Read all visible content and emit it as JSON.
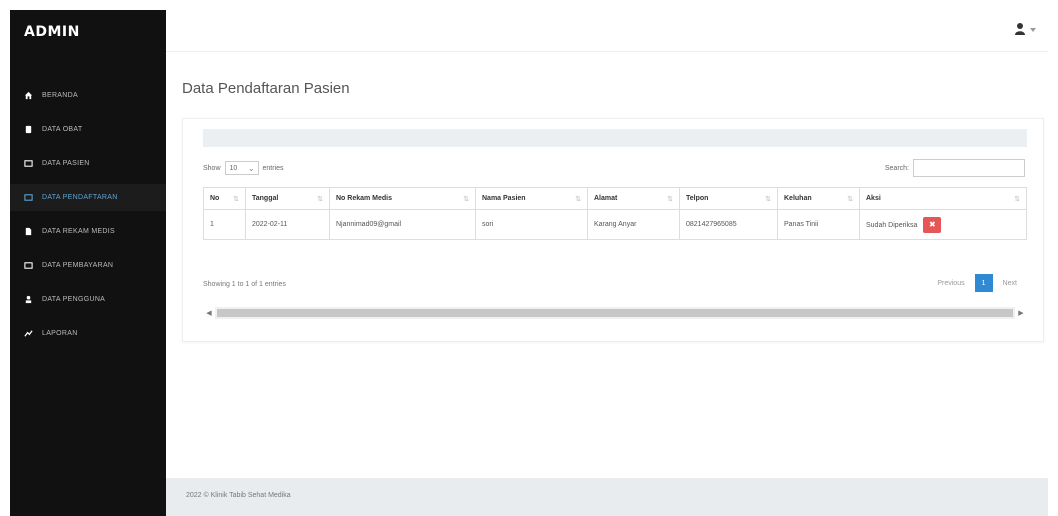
{
  "sidebar": {
    "brand": "ADMIN",
    "items": [
      {
        "label": "BERANDA",
        "icon": "home-icon",
        "active": false
      },
      {
        "label": "DATA OBAT",
        "icon": "pill-icon",
        "active": false
      },
      {
        "label": "DATA PASIEN",
        "icon": "folder-icon",
        "active": false
      },
      {
        "label": "DATA PENDAFTARAN",
        "icon": "folder-icon",
        "active": true
      },
      {
        "label": "DATA REKAM MEDIS",
        "icon": "file-icon",
        "active": false
      },
      {
        "label": "DATA PEMBAYARAN",
        "icon": "folder-icon",
        "active": false
      },
      {
        "label": "DATA PENGGUNA",
        "icon": "user-icon",
        "active": false
      },
      {
        "label": "LAPORAN",
        "icon": "report-icon",
        "active": false
      }
    ]
  },
  "topbar": {
    "user_icon": "user-icon"
  },
  "page": {
    "title": "Data Pendaftaran Pasien"
  },
  "table_controls": {
    "show_label": "Show",
    "show_value": "10",
    "entries_label": "entries",
    "search_label": "Search:",
    "search_value": ""
  },
  "table": {
    "headers": [
      "No",
      "Tanggal",
      "No Rekam Medis",
      "Nama Pasien",
      "Alamat",
      "Telpon",
      "Keluhan",
      "Aksi"
    ],
    "rows": [
      {
        "no": "1",
        "tanggal": "2022-02-11",
        "rekam_medis": "Njannimad09@gmail",
        "nama": "sori",
        "alamat": "Karang Anyar",
        "telpon": "0821427965085",
        "keluhan": "Panas Tinii",
        "status": "Sudah Diperiksa"
      }
    ]
  },
  "footer_info": {
    "showing": "Showing 1 to 1 of 1 entries",
    "previous": "Previous",
    "current_page": "1",
    "next": "Next"
  },
  "footer": {
    "text": "2022 © Klinik Tabib Sehat Medika"
  },
  "colors": {
    "sidebar_bg": "#111111",
    "active_text": "#5aa6d6",
    "page_active": "#2f8ad3",
    "delete_btn": "#e55656"
  }
}
